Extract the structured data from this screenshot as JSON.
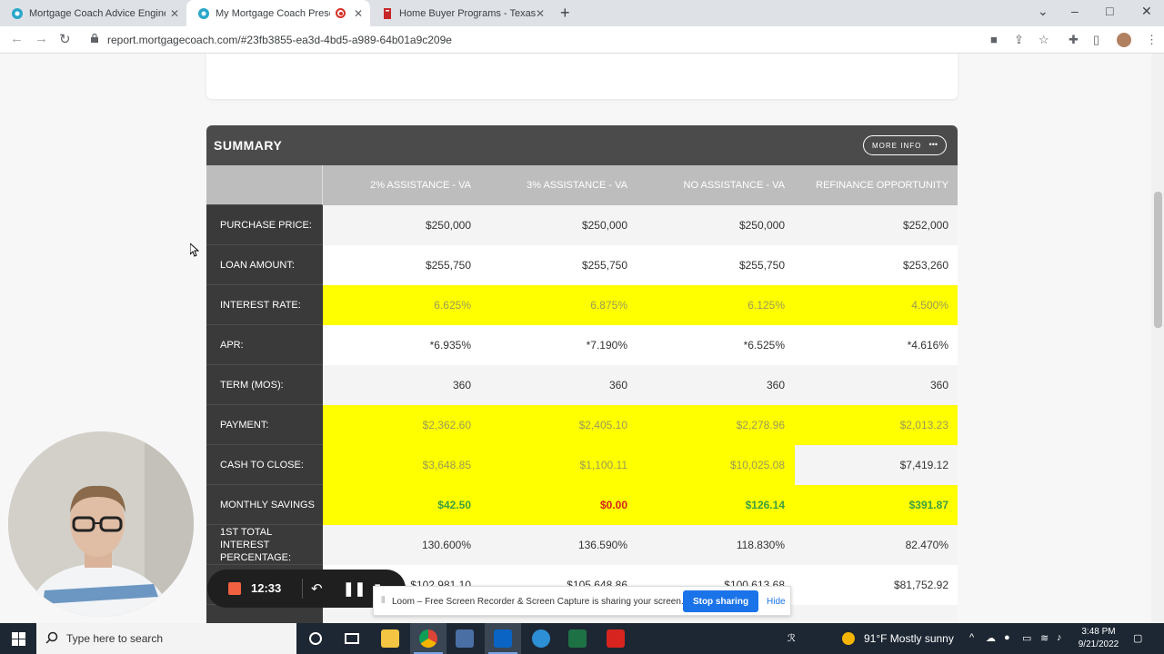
{
  "browser": {
    "tabs": [
      {
        "title": "Mortgage Coach Advice Engine",
        "active": false
      },
      {
        "title": "My Mortgage Coach Present",
        "active": true,
        "recording": true
      },
      {
        "title": "Home Buyer Programs - Texas St",
        "active": false
      }
    ],
    "url": "report.mortgagecoach.com/#23fb3855-ea3d-4bd5-a989-64b01a9c209e"
  },
  "summary": {
    "title": "SUMMARY",
    "more_info": "MORE INFO",
    "more_info_dots": "•••",
    "columns": [
      "2% ASSISTANCE - VA",
      "3% ASSISTANCE - VA",
      "NO ASSISTANCE - VA",
      "REFINANCE OPPORTUNITY"
    ],
    "rows": [
      {
        "label": "PURCHASE PRICE:",
        "values": [
          "$250,000",
          "$250,000",
          "$250,000",
          "$252,000"
        ]
      },
      {
        "label": "LOAN AMOUNT:",
        "values": [
          "$255,750",
          "$255,750",
          "$255,750",
          "$253,260"
        ]
      },
      {
        "label": "INTEREST RATE:",
        "values": [
          "6.625%",
          "6.875%",
          "6.125%",
          "4.500%"
        ]
      },
      {
        "label": "APR:",
        "values": [
          "*6.935%",
          "*7.190%",
          "*6.525%",
          "*4.616%"
        ]
      },
      {
        "label": "TERM (MOS):",
        "values": [
          "360",
          "360",
          "360",
          "360"
        ]
      },
      {
        "label": "PAYMENT:",
        "values": [
          "$2,362.60",
          "$2,405.10",
          "$2,278.96",
          "$2,013.23"
        ]
      },
      {
        "label": "CASH TO CLOSE:",
        "values": [
          "$3,648.85",
          "$1,100.11",
          "$10,025.08",
          "$7,419.12"
        ]
      },
      {
        "label": "MONTHLY SAVINGS",
        "values": [
          "$42.50",
          "$0.00",
          "$126.14",
          "$391.87"
        ]
      },
      {
        "label": "1ST TOTAL INTEREST PERCENTAGE:",
        "values": [
          "130.600%",
          "136.590%",
          "118.830%",
          "82.470%"
        ]
      },
      {
        "label": "",
        "values": [
          "$102,981.10",
          "$105,648.86",
          "$100,613.68",
          "$81,752.92"
        ]
      }
    ]
  },
  "recorder": {
    "time": "12:33"
  },
  "sharebar": {
    "message": "Loom – Free Screen Recorder & Screen Capture is sharing your screen.",
    "stop_label": "Stop sharing",
    "hide_label": "Hide"
  },
  "taskbar": {
    "search_placeholder": "Type here to search",
    "weather": "91°F  Mostly sunny",
    "time": "3:48 PM",
    "date": "9/21/2022"
  },
  "colors": {
    "header_dark": "#4b4b4b",
    "label_dark": "#3a3a3a",
    "highlight": "#ffff00",
    "savings_green": "#3e9e44",
    "savings_red": "#d32222",
    "loom_blue": "#1a73e8"
  }
}
